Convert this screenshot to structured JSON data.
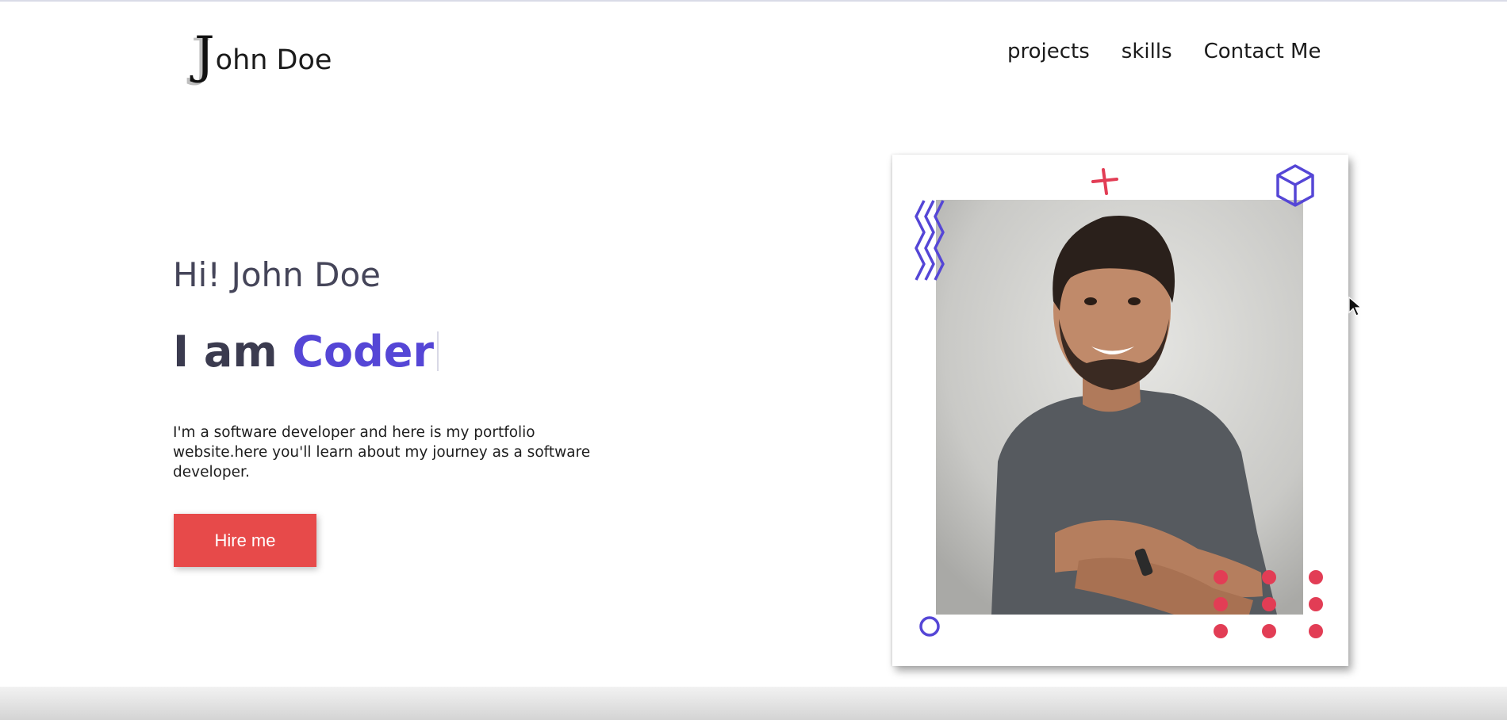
{
  "header": {
    "logo_initial": "J",
    "logo_rest": "ohn Doe",
    "nav": [
      "projects",
      "skills",
      "Contact Me"
    ]
  },
  "hero": {
    "greeting": "Hi! John Doe",
    "role_prefix": "I am ",
    "role_highlight": "Coder",
    "description": "I'm a software developer and here is my portfolio website.here you'll learn about my journey as a software developer.",
    "cta_label": "Hire me"
  },
  "colors": {
    "accent": "#5546d6",
    "button": "#e74a4a",
    "decor_red": "#e23d55"
  },
  "icons": [
    "cube-icon",
    "plus-icon",
    "zigzag-icon",
    "circle-icon",
    "dot-grid-icon",
    "cursor-icon"
  ]
}
